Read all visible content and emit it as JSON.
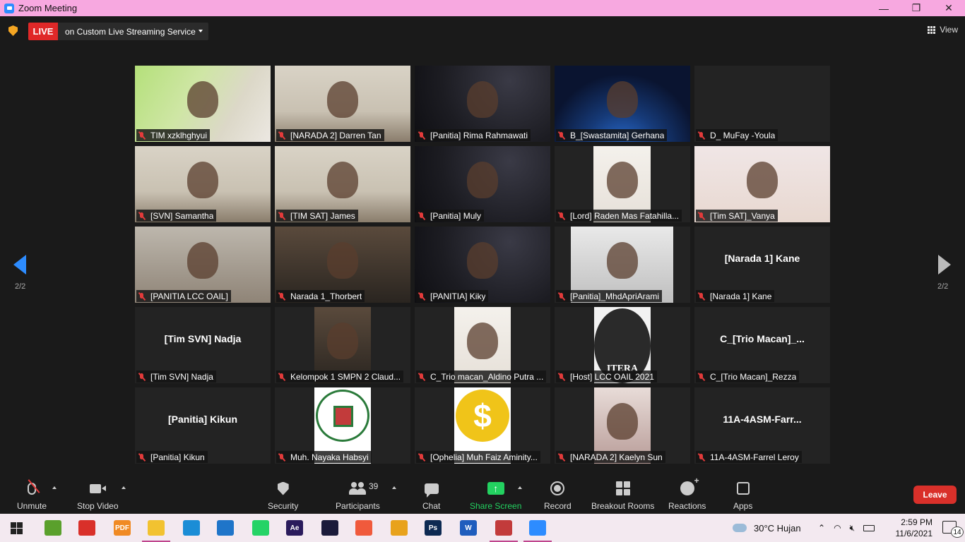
{
  "window": {
    "title": "Zoom Meeting",
    "controls": {
      "minimize": "—",
      "maximize": "❐",
      "close": "✕"
    }
  },
  "topbar": {
    "live_label": "LIVE",
    "live_destination": "on Custom Live Streaming Service",
    "view_label": "View"
  },
  "pagination": {
    "left_label": "2/2",
    "right_label": "2/2"
  },
  "participants": [
    {
      "name": "TIM xzklhghyui",
      "video": "v-green",
      "center": ""
    },
    {
      "name": "[NARADA 2] Darren Tan",
      "video": "v-room",
      "center": ""
    },
    {
      "name": "[Panitia] Rima Rahmawati",
      "video": "v-astro",
      "center": ""
    },
    {
      "name": "B_[Swastamita] Gerhana",
      "video": "v-earth",
      "center": ""
    },
    {
      "name": "D_ MuFay -Youla",
      "video": "v-white",
      "center": ""
    },
    {
      "name": "[SVN] Samantha",
      "video": "v-room",
      "center": ""
    },
    {
      "name": "[TIM SAT] James",
      "video": "v-room",
      "center": ""
    },
    {
      "name": "[Panitia] Muly",
      "video": "v-astro",
      "center": ""
    },
    {
      "name": "[Lord] Raden Mas Fatahilla...",
      "video": "v-white",
      "center": ""
    },
    {
      "name": "[Tim SAT]_Vanya",
      "video": "v-red",
      "center": ""
    },
    {
      "name": "[PANITIA LCC OAIL]",
      "video": "v-office",
      "center": ""
    },
    {
      "name": "Narada 1_Thorbert",
      "video": "v-dark",
      "center": ""
    },
    {
      "name": "[PANITIA] Kiky",
      "video": "v-astro",
      "center": ""
    },
    {
      "name": "[Panitia]_MhdApriArami",
      "video": "v-ceiling",
      "center": ""
    },
    {
      "name": "[Narada 1] Kane",
      "video": "",
      "center": "[Narada 1] Kane"
    },
    {
      "name": "[Tim SVN] Nadja",
      "video": "",
      "center": "[Tim SVN] Nadja"
    },
    {
      "name": "Kelompok 1 SMPN 2 Claud...",
      "video": "v-dark",
      "center": ""
    },
    {
      "name": "C_Trio macan_Aldino Putra ...",
      "video": "v-white",
      "center": ""
    },
    {
      "name": "[Host] LCC OAIL 2021",
      "video": "v-logo-itera",
      "center": ""
    },
    {
      "name": "C_[Trio Macan]_Rezza",
      "video": "",
      "center": "C_[Trio  Macan]_..."
    },
    {
      "name": "[Panitia] Kikun",
      "video": "",
      "center": "[Panitia] Kikun"
    },
    {
      "name": "Muh. Nayaka Habsyi",
      "video": "v-yellow",
      "center": ""
    },
    {
      "name": "[Ophelia] Muh Faiz Aminity...",
      "video": "v-yellow",
      "center": ""
    },
    {
      "name": "[NARADA 2] Kaelyn Sun",
      "video": "v-anime",
      "center": ""
    },
    {
      "name": "11A-4ASM-Farrel Leroy",
      "video": "",
      "center": "11A-4ASM-Farr..."
    }
  ],
  "logos": {
    "itera_text": "ITERA",
    "dollar_sign": "$"
  },
  "toolbar": {
    "unmute": "Unmute",
    "stop_video": "Stop Video",
    "security": "Security",
    "participants": "Participants",
    "participant_count": "39",
    "chat": "Chat",
    "share_screen": "Share Screen",
    "record": "Record",
    "breakout_rooms": "Breakout Rooms",
    "reactions": "Reactions",
    "apps": "Apps",
    "leave": "Leave"
  },
  "taskbar": {
    "weather": "30°C  Hujan",
    "time": "2:59 PM",
    "date": "11/6/2021",
    "notification_count": "14",
    "apps": [
      {
        "name": "camtasia-app",
        "color": "#5aa02c",
        "label": ""
      },
      {
        "name": "screenshot-app",
        "color": "#d9302a",
        "label": ""
      },
      {
        "name": "pdf-app",
        "color": "#f08a24",
        "label": "PDF"
      },
      {
        "name": "file-explorer",
        "color": "#f2c230",
        "label": ""
      },
      {
        "name": "edge-browser",
        "color": "#1b8dd6",
        "label": ""
      },
      {
        "name": "vscode-app",
        "color": "#1f75c9",
        "label": ""
      },
      {
        "name": "whatsapp-app",
        "color": "#25d366",
        "label": ""
      },
      {
        "name": "after-effects-app",
        "color": "#2a1b5c",
        "label": "Ae"
      },
      {
        "name": "stellarium-app",
        "color": "#1b1b3a",
        "label": ""
      },
      {
        "name": "screen-recorder-app",
        "color": "#f05a3c",
        "label": ""
      },
      {
        "name": "chrome-browser",
        "color": "#e8a21c",
        "label": ""
      },
      {
        "name": "photoshop-app",
        "color": "#0d2a52",
        "label": "Ps"
      },
      {
        "name": "word-app",
        "color": "#1f5dbd",
        "label": "W"
      },
      {
        "name": "chrome-profile-app",
        "color": "#c23b3b",
        "label": ""
      },
      {
        "name": "zoom-app",
        "color": "#2d8cff",
        "label": ""
      }
    ]
  }
}
